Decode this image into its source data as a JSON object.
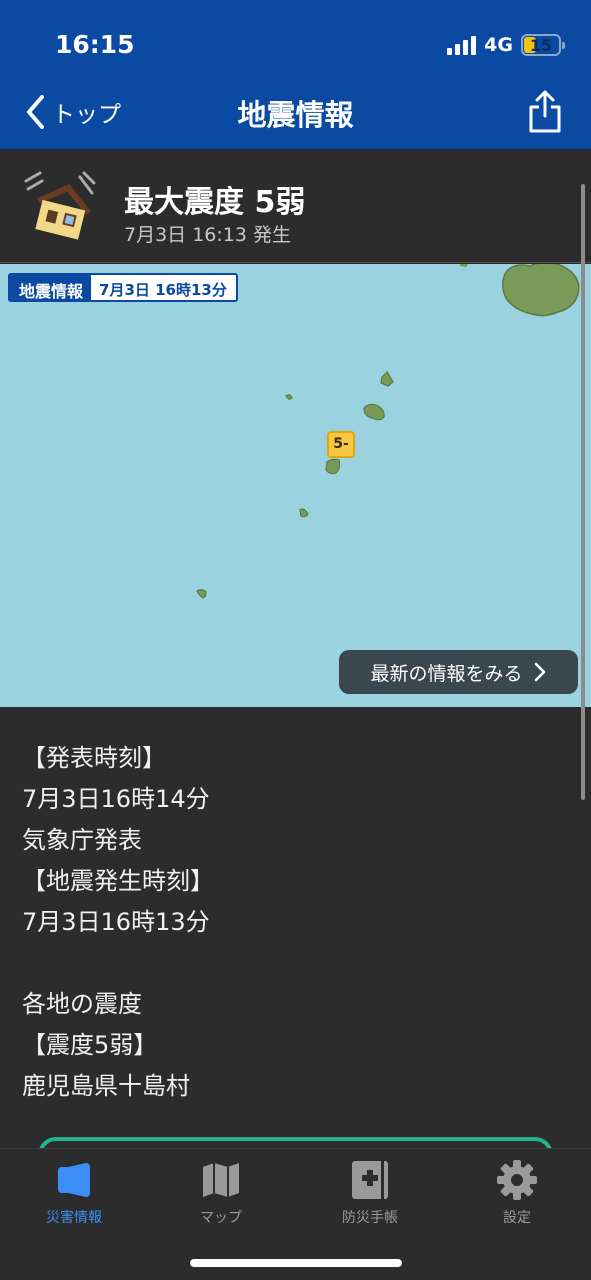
{
  "status_bar": {
    "time": "16:15",
    "network": "4G",
    "battery": "15"
  },
  "nav": {
    "back_label": "トップ",
    "title": "地震情報"
  },
  "alert": {
    "intensity": "最大震度 5弱",
    "occurred": "7月3日 16:13 発生"
  },
  "map": {
    "label_title": "地震情報",
    "label_time": "7月3日  16時13分",
    "marker_intensity": "5-",
    "latest_button": "最新の情報をみる"
  },
  "details": {
    "lines": [
      "【発表時刻】",
      "7月3日16時14分",
      "気象庁発表",
      "【地震発生時刻】",
      "7月3日16時13分",
      "",
      "各地の震度",
      "【震度5弱】",
      "鹿児島県十島村"
    ]
  },
  "tabs": [
    {
      "label": "災害情報",
      "icon": "megaphone-icon",
      "active": true
    },
    {
      "label": "マップ",
      "icon": "map-icon",
      "active": false
    },
    {
      "label": "防災手帳",
      "icon": "first-aid-book-icon",
      "active": false
    },
    {
      "label": "設定",
      "icon": "gear-icon",
      "active": false
    }
  ],
  "colors": {
    "header": "#0b4aa2",
    "sea": "#9ad2e0",
    "land": "#7a9a5a",
    "accent": "#3c8df6",
    "marker": "#f7c744"
  }
}
